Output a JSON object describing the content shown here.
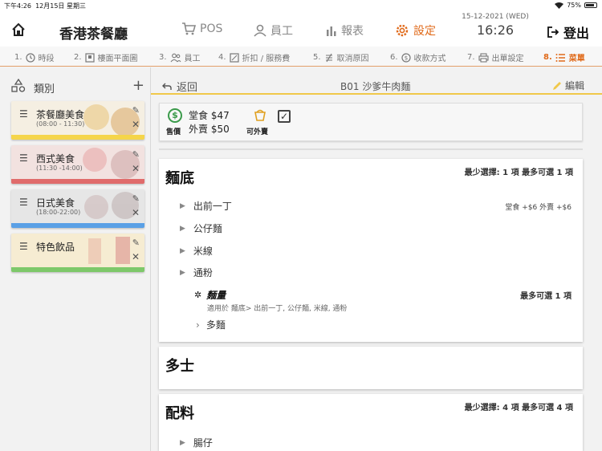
{
  "status": {
    "time": "下午4:26",
    "date": "12月15日 星期三",
    "battery": "75%"
  },
  "header": {
    "shop_name": "香港茶餐廳",
    "nav": {
      "pos": "POS",
      "staff": "員工",
      "reports": "報表",
      "settings": "設定"
    },
    "date": "15-12-2021 (WED)",
    "time": "16:26",
    "logout": "登出"
  },
  "steps": [
    {
      "num": "1.",
      "label": "時段"
    },
    {
      "num": "2.",
      "label": "樓面平面圖"
    },
    {
      "num": "3.",
      "label": "員工"
    },
    {
      "num": "4.",
      "label": "折扣 / 服務費"
    },
    {
      "num": "5.",
      "label": "取消原因"
    },
    {
      "num": "6.",
      "label": "收款方式"
    },
    {
      "num": "7.",
      "label": "出單設定"
    },
    {
      "num": "8.",
      "label": "菜單"
    }
  ],
  "sidebar": {
    "title": "類別",
    "categories": [
      {
        "name": "茶餐廳美食",
        "hours": "(08:00 - 11:30)",
        "color": "#f5d54a"
      },
      {
        "name": "西式美食",
        "hours": "(11:30 -14:00)",
        "color": "#e06b6b"
      },
      {
        "name": "日式美食",
        "hours": "(18:00-22:00)",
        "color": "#5aa0e6"
      },
      {
        "name": "特色飲品",
        "hours": "",
        "color": "#7ec86a"
      }
    ]
  },
  "main": {
    "back": "返回",
    "item_title": "B01 沙爹牛肉麵",
    "edit": "編輯",
    "price": {
      "sell_label": "售價",
      "dine_in": "堂食 $47",
      "takeaway": "外賣 $50",
      "takeaway_label": "可外賣"
    },
    "groups": [
      {
        "name": "麵底",
        "rule": "最少選擇: 1 項  最多可選 1 項",
        "options": [
          {
            "label": "出前一丁",
            "price": "堂食 +$6  外賣 +$6"
          },
          {
            "label": "公仔麵"
          },
          {
            "label": "米線"
          },
          {
            "label": "通粉"
          }
        ],
        "addon": {
          "title": "麵量",
          "rule": "最多可選 1 項",
          "desc": "適用於 麵底> 出前一丁, 公仔麵, 米線, 通粉",
          "option": "多麵"
        }
      },
      {
        "name": "多士"
      },
      {
        "name": "配料",
        "rule": "最少選擇: 4 項  最多可選 4 項",
        "options": [
          {
            "label": "腸仔"
          }
        ]
      }
    ]
  },
  "colors": {
    "accent": "#e06a1a",
    "yellow": "#f0c84a",
    "green": "#3a9a4a"
  }
}
